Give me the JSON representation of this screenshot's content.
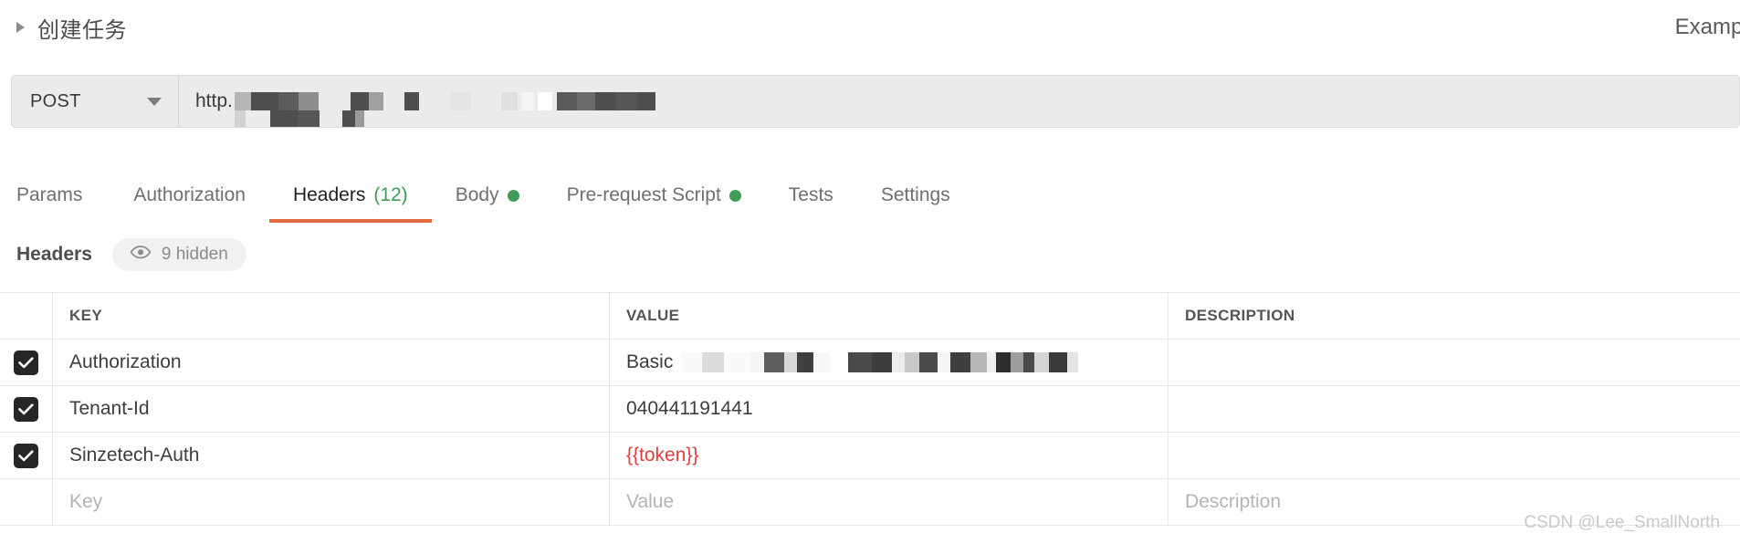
{
  "titlebar": {
    "request_name": "创建任务",
    "disclosure_icon": "triangle-right-icon",
    "right_label": "Examples"
  },
  "urlbar": {
    "method": "POST",
    "method_caret_icon": "chevron-down-icon",
    "url_visible_prefix": "http.",
    "url_redacted": true
  },
  "tabs": [
    {
      "label": "Params",
      "active": false,
      "count": "",
      "dot": false
    },
    {
      "label": "Authorization",
      "active": false,
      "count": "",
      "dot": false
    },
    {
      "label": "Headers",
      "active": true,
      "count": "(12)",
      "dot": false
    },
    {
      "label": "Body",
      "active": false,
      "count": "",
      "dot": true
    },
    {
      "label": "Pre-request Script",
      "active": false,
      "count": "",
      "dot": true
    },
    {
      "label": "Tests",
      "active": false,
      "count": "",
      "dot": false
    },
    {
      "label": "Settings",
      "active": false,
      "count": "",
      "dot": false
    }
  ],
  "section": {
    "title": "Headers",
    "hidden_pill": {
      "icon": "eye-icon",
      "label": "9 hidden"
    }
  },
  "table": {
    "columns": {
      "key": "KEY",
      "value": "VALUE",
      "description": "DESCRIPTION"
    },
    "rows": [
      {
        "checked": true,
        "key": "Authorization",
        "value": "Basic",
        "value_redacted": true,
        "value_is_variable": false,
        "description": ""
      },
      {
        "checked": true,
        "key": "Tenant-Id",
        "value": "040441191441",
        "value_redacted": false,
        "value_is_variable": false,
        "description": ""
      },
      {
        "checked": true,
        "key": "Sinzetech-Auth",
        "value": "{{token}}",
        "value_redacted": false,
        "value_is_variable": true,
        "description": ""
      }
    ],
    "new_row_placeholders": {
      "key": "Key",
      "value": "Value",
      "description": "Description"
    }
  },
  "watermark": "CSDN @Lee_SmallNorth",
  "colors": {
    "accent_underline": "#e26b3f",
    "count_green": "#3f9b55",
    "variable_red": "#e33e3e",
    "checkbox_dark": "#262626",
    "urlbar_bg": "#ebebeb"
  }
}
